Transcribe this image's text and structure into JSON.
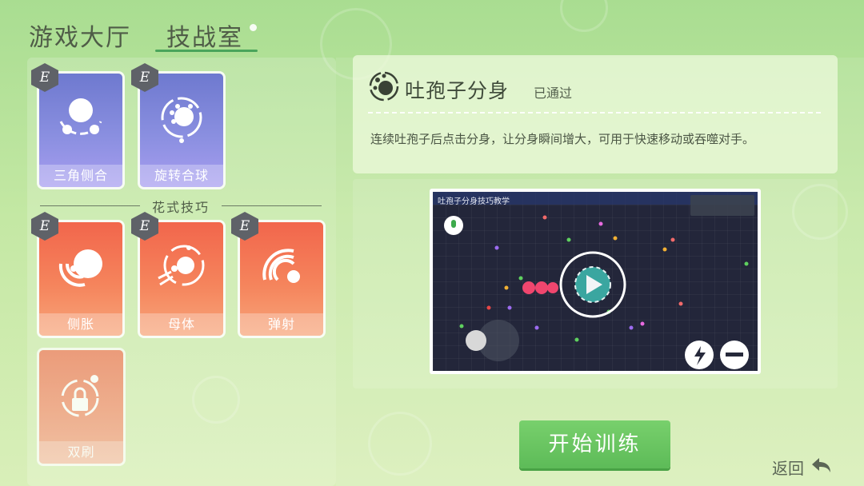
{
  "tabs": {
    "lobby": "游戏大厅",
    "skill_room": "技战室"
  },
  "grade": "E",
  "cards_basic": [
    {
      "label": "三角侧合",
      "grade": "E"
    },
    {
      "label": "旋转合球",
      "grade": "E"
    }
  ],
  "section_title": "花式技巧",
  "cards_fancy": [
    {
      "label": "侧胀",
      "grade": "E"
    },
    {
      "label": "母体",
      "grade": "E"
    },
    {
      "label": "弹射",
      "grade": "E"
    }
  ],
  "cards_locked": [
    {
      "label": "双刷"
    }
  ],
  "detail": {
    "title": "吐孢子分身",
    "status": "已通过",
    "description": "连续吐孢子后点击分身，让分身瞬间增大，可用于快速移动或吞噬对手。"
  },
  "video": {
    "title": "吐孢子分身技巧教学"
  },
  "start_button": "开始训练",
  "back_button": "返回",
  "colors": {
    "accent_green": "#5dbb58",
    "card_purple": "#7e84da",
    "card_orange": "#f47454",
    "badge_gray": "#5f6268"
  }
}
